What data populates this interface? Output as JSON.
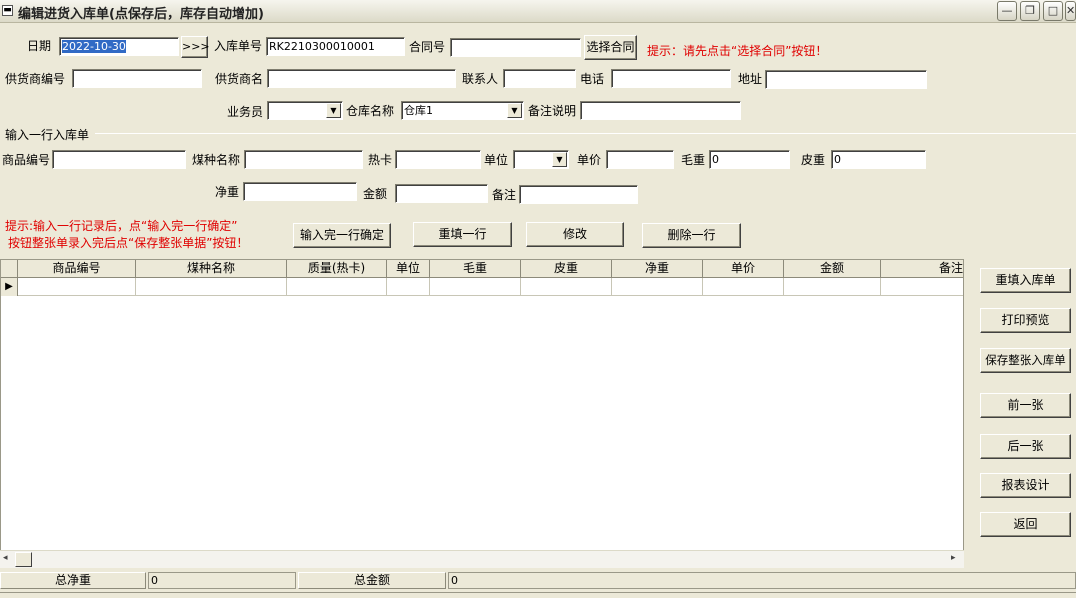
{
  "window": {
    "title": "编辑进货入库单(点保存后，库存自动增加)",
    "minimize": "—",
    "restore": "❐",
    "maximize": "□",
    "close": "✕"
  },
  "header": {
    "date_label": "日期",
    "date_value": "2022-10-30",
    "date_button": ">>>",
    "receipt_no_label": "入库单号",
    "receipt_no_value": "RK2210300010001",
    "contract_no_label": "合同号",
    "contract_no_value": "",
    "select_contract_button": "选择合同",
    "hint_contract": "提示：请先点击“选择合同”按钮！",
    "supplier_no_label": "供货商编号",
    "supplier_no_value": "",
    "supplier_name_label": "供货商名",
    "supplier_name_value": "",
    "contact_label": "联系人",
    "contact_value": "",
    "phone_label": "电话",
    "phone_value": "",
    "address_label": "地址",
    "address_value": "",
    "salesman_label": "业务员",
    "salesman_value": "",
    "warehouse_label": "仓库名称",
    "warehouse_value": "仓库1",
    "remark_label": "备注说明",
    "remark_value": ""
  },
  "line_entry": {
    "group_title": "输入一行入库单",
    "product_no_label": "商品编号",
    "product_no_value": "",
    "coal_name_label": "煤种名称",
    "coal_name_value": "",
    "heat_label": "热卡",
    "heat_value": "",
    "unit_label": "单位",
    "unit_value": "",
    "price_label": "单价",
    "price_value": "",
    "gross_label": "毛重",
    "gross_value": "0",
    "tare_label": "皮重",
    "tare_value": "0",
    "net_label": "净重",
    "net_value": "",
    "amount_label": "金额",
    "amount_value": "",
    "note_label": "备注",
    "note_value": "",
    "hint_line1": "提示:输入一行记录后，点“输入完一行确定”",
    "hint_line2": "按钮整张单录入完后点“保存整张单据”按钮！",
    "confirm_row_button": "输入完一行确定",
    "refill_row_button": "重填一行",
    "modify_button": "修改",
    "delete_row_button": "删除一行"
  },
  "grid": {
    "columns": [
      "商品编号",
      "煤种名称",
      "质量(热卡)",
      "单位",
      "毛重",
      "皮重",
      "净重",
      "单价",
      "金额",
      "备注"
    ],
    "row_indicator": "▶"
  },
  "side_buttons": {
    "refill_receipt": "重填入库单",
    "print_preview": "打印预览",
    "save_receipt": "保存整张入库单",
    "prev": "前一张",
    "next": "后一张",
    "report_design": "报表设计",
    "back": "返回"
  },
  "summary": {
    "total_net_label": "总净重",
    "total_net_value": "0",
    "total_amount_label": "总金额",
    "total_amount_value": "0"
  }
}
